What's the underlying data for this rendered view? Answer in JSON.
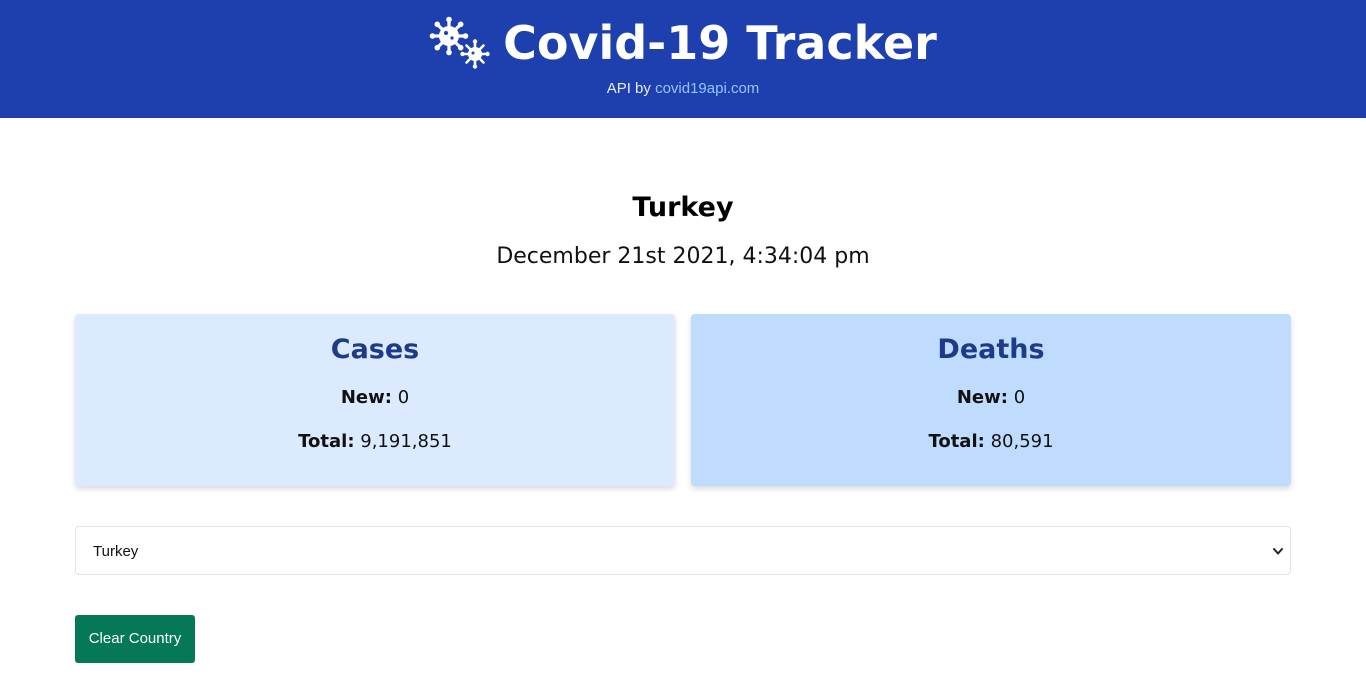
{
  "header": {
    "title": "Covid-19 Tracker",
    "icon": "virus-icon",
    "credit_prefix": "API by",
    "credit_link": "covid19api.com"
  },
  "country": {
    "name": "Turkey",
    "date": "December 21st 2021, 4:34:04 pm"
  },
  "cards": {
    "cases": {
      "title": "Cases",
      "new_label": "New:",
      "new_value": "0",
      "total_label": "Total:",
      "total_value": "9,191,851"
    },
    "deaths": {
      "title": "Deaths",
      "new_label": "New:",
      "new_value": "0",
      "total_label": "Total:",
      "total_value": "80,591"
    }
  },
  "select": {
    "selected": "Turkey",
    "icon": "chevron-down-icon"
  },
  "buttons": {
    "clear": "Clear Country"
  },
  "colors": {
    "header_bg": "#1e40af",
    "link": "#93c5fd",
    "cases_bg": "#dbeafe",
    "deaths_bg": "#bfdbfe",
    "card_title": "#1e3a8a",
    "button_bg": "#047857"
  }
}
